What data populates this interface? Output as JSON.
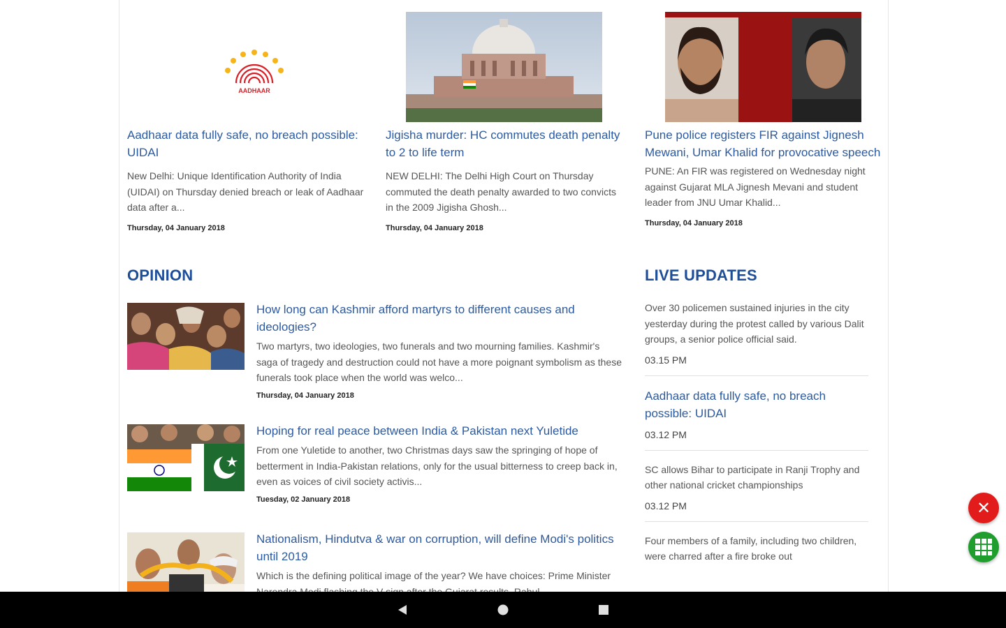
{
  "top_stories": [
    {
      "headline": "Aadhaar data fully safe, no breach possible: UIDAI",
      "desc": "New Delhi: Unique Identification Authority of India (UIDAI) on Thursday denied breach or leak of Aadhaar data after a...",
      "date": "Thursday, 04 January 2018",
      "logo_text": "AADHAAR"
    },
    {
      "headline": "Jigisha murder: HC commutes death penalty to 2 to life term",
      "desc": "NEW DELHI: The Delhi High Court on Thursday commuted the death penalty awarded to two convicts in the 2009 Jigisha Ghosh...",
      "date": "Thursday, 04 January 2018"
    },
    {
      "headline": "Pune police registers FIR against Jignesh Mewani, Umar Khalid for provocative speech",
      "desc": "PUNE: An FIR was registered on Wednesday night against Gujarat MLA Jignesh Mevani and student leader from JNU Umar Khalid...",
      "date": "Thursday, 04 January 2018"
    }
  ],
  "opinion": {
    "title": "OPINION",
    "items": [
      {
        "headline": "How long can Kashmir afford martyrs to different causes and ideologies?",
        "desc": "Two martyrs, two ideologies, two funerals and two mourning families. Kashmir's saga of tragedy and destruction could not have a more poignant symbolism as these funerals took place when the world was welco...",
        "date": "Thursday, 04 January 2018"
      },
      {
        "headline": "Hoping for real peace between India & Pakistan next Yuletide",
        "desc": "From one Yuletide to another, two Christmas days saw the springing of hope of betterment in India-Pakistan relations, only for the usual bitterness to creep back in, even as voices of civil society activis...",
        "date": "Tuesday, 02 January 2018"
      },
      {
        "headline": "Nationalism, Hindutva & war on corruption, will define Modi's politics until 2019",
        "desc": "Which is the defining political image of the year? We have choices: Prime Minister Narendra Modi flashing the V sign after the Gujarat results, Rahul...",
        "date": ""
      }
    ]
  },
  "live_updates": {
    "title": "LIVE UPDATES",
    "items": [
      {
        "text": "Over 30 policemen sustained injuries in the city yesterday during the protest called by various Dalit groups, a senior police official said.",
        "time": "03.15 PM",
        "is_link": false
      },
      {
        "text": "Aadhaar data fully safe, no breach possible: UIDAI",
        "time": "03.12 PM",
        "is_link": true
      },
      {
        "text": "SC allows Bihar to participate in Ranji Trophy and other national cricket championships",
        "time": "03.12 PM",
        "is_link": false
      },
      {
        "text": "Four members of a family, including two children, were charred after a fire broke out",
        "time": "",
        "is_link": false
      }
    ]
  },
  "fab": {
    "close": "✕"
  }
}
